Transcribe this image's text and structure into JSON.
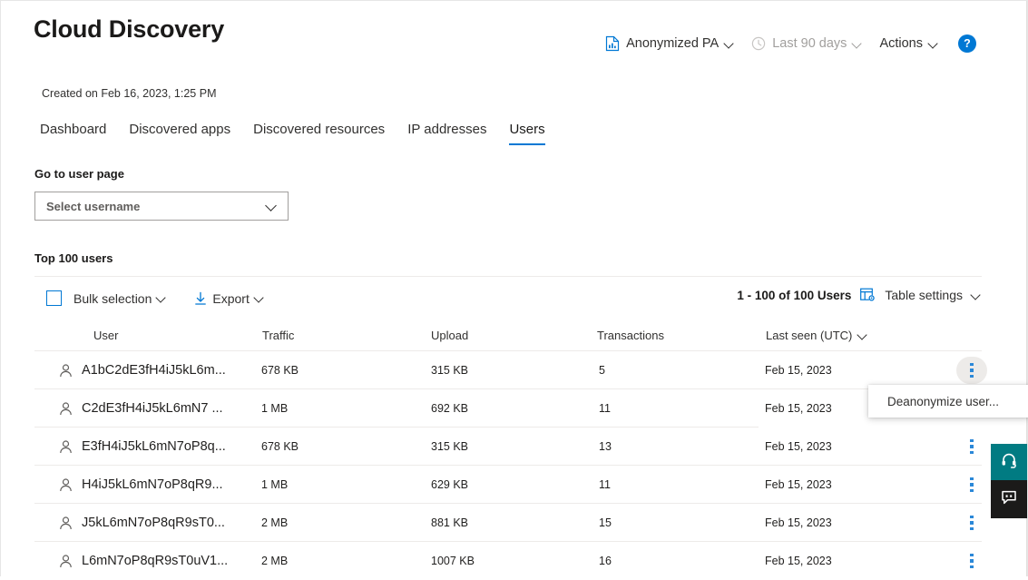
{
  "header": {
    "title": "Cloud Discovery",
    "created": "Created on Feb 16, 2023, 1:25 PM",
    "tools": {
      "report_label": "Anonymized PA",
      "report_icon": "report-chart-icon",
      "period_label": "Last 90 days",
      "period_icon": "clock-icon",
      "actions_label": "Actions",
      "help_label": "?"
    }
  },
  "tabs": [
    {
      "label": "Dashboard",
      "active": false
    },
    {
      "label": "Discovered apps",
      "active": false
    },
    {
      "label": "Discovered resources",
      "active": false
    },
    {
      "label": "IP addresses",
      "active": false
    },
    {
      "label": "Users",
      "active": true
    }
  ],
  "user_page": {
    "label": "Go to user page",
    "select_placeholder": "Select username"
  },
  "table_section": {
    "title": "Top 100 users",
    "toolbar": {
      "bulk_selection_label": "Bulk selection",
      "export_label": "Export",
      "count_label": "1 - 100 of 100 Users",
      "table_settings_label": "Table settings"
    },
    "columns": [
      {
        "label": "User"
      },
      {
        "label": "Traffic"
      },
      {
        "label": "Upload"
      },
      {
        "label": "Transactions"
      },
      {
        "label": "Last seen (UTC)"
      }
    ],
    "rows": [
      {
        "user": "A1bC2dE3fH4iJ5kL6m...",
        "traffic": "678 KB",
        "upload": "315 KB",
        "transactions": "5",
        "last_seen": "Feb 15, 2023"
      },
      {
        "user": "C2dE3fH4iJ5kL6mN7 ...",
        "traffic": "1 MB",
        "upload": "692 KB",
        "transactions": "11",
        "last_seen": "Feb 15, 2023"
      },
      {
        "user": "E3fH4iJ5kL6mN7oP8q...",
        "traffic": "678 KB",
        "upload": "315 KB",
        "transactions": "13",
        "last_seen": "Feb 15, 2023"
      },
      {
        "user": "H4iJ5kL6mN7oP8qR9...",
        "traffic": "1 MB",
        "upload": "629 KB",
        "transactions": "11",
        "last_seen": "Feb 15, 2023"
      },
      {
        "user": "J5kL6mN7oP8qR9sT0...",
        "traffic": "2 MB",
        "upload": "881 KB",
        "transactions": "15",
        "last_seen": "Feb 15, 2023"
      },
      {
        "user": "L6mN7oP8qR9sT0uV1...",
        "traffic": "2 MB",
        "upload": "1007 KB",
        "transactions": "16",
        "last_seen": "Feb 15, 2023"
      }
    ]
  },
  "context_menu": {
    "items": [
      {
        "label": "Deanonymize user..."
      }
    ]
  },
  "floating_buttons": [
    {
      "name": "support-button",
      "icon": "headset-icon",
      "color": "#017b82"
    },
    {
      "name": "feedback-button",
      "icon": "speech-bubble-icon",
      "color": "#1b1a19"
    }
  ],
  "colors": {
    "accent": "#0078d4",
    "teal": "#017b82",
    "dark": "#1b1a19",
    "divider": "#edebe9"
  }
}
